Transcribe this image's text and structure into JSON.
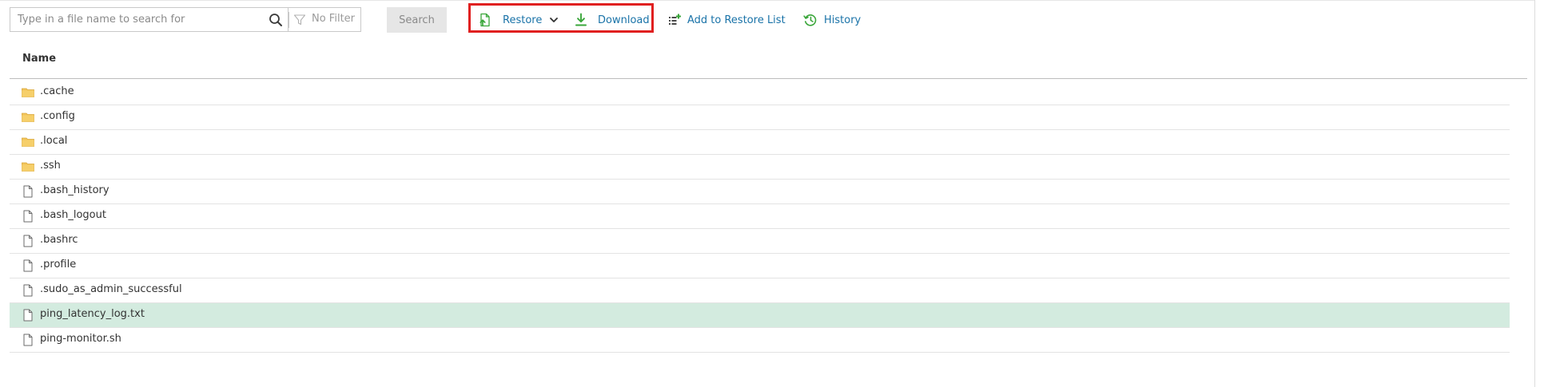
{
  "search": {
    "placeholder": "Type in a file name to search for",
    "value": ""
  },
  "filter": {
    "label": "No Filter"
  },
  "toolbar": {
    "search_label": "Search",
    "restore_label": "Restore",
    "download_label": "Download",
    "add_to_restore_list_label": "Add to Restore List",
    "history_label": "History"
  },
  "table": {
    "column_name": "Name",
    "rows": [
      {
        "name": ".cache",
        "type": "folder",
        "selected": false
      },
      {
        "name": ".config",
        "type": "folder",
        "selected": false
      },
      {
        "name": ".local",
        "type": "folder",
        "selected": false
      },
      {
        "name": ".ssh",
        "type": "folder",
        "selected": false
      },
      {
        "name": ".bash_history",
        "type": "file",
        "selected": false
      },
      {
        "name": ".bash_logout",
        "type": "file",
        "selected": false
      },
      {
        "name": ".bashrc",
        "type": "file",
        "selected": false
      },
      {
        "name": ".profile",
        "type": "file",
        "selected": false
      },
      {
        "name": ".sudo_as_admin_successful",
        "type": "file",
        "selected": false
      },
      {
        "name": "ping_latency_log.txt",
        "type": "file",
        "selected": true
      },
      {
        "name": "ping-monitor.sh",
        "type": "file",
        "selected": false
      }
    ]
  },
  "colors": {
    "link": "#1a73a8",
    "icon_green": "#3aa63a",
    "selected_row": "#d3ebdf",
    "folder": "#f2c45a",
    "highlight": "#e02020"
  }
}
